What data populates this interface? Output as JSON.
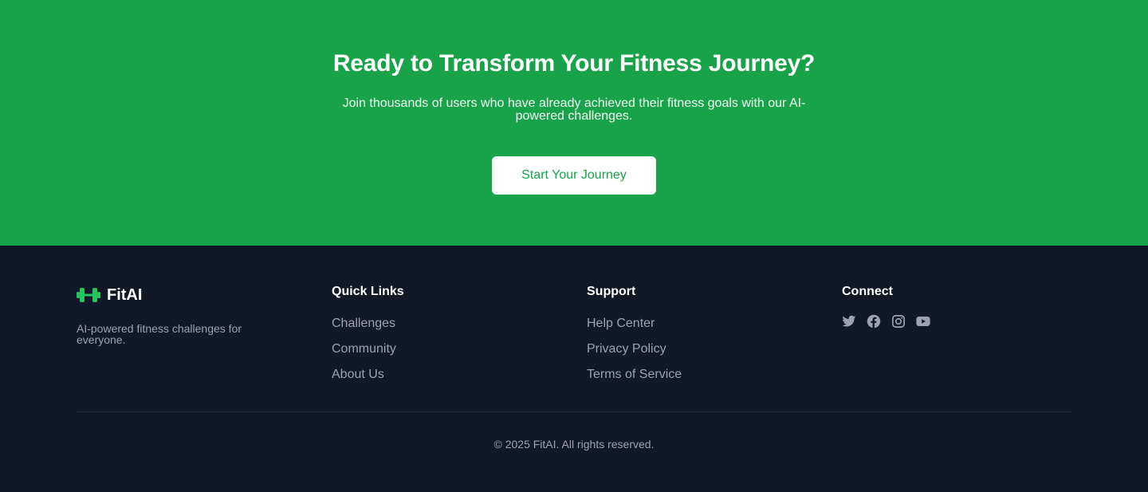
{
  "cta": {
    "title": "Ready to Transform Your Fitness Journey?",
    "subtitle": "Join thousands of users who have already achieved their fitness goals with our AI-powered challenges.",
    "button_label": "Start Your Journey"
  },
  "footer": {
    "brand": {
      "name": "FitAI",
      "icon": "dumbbell-icon",
      "description": "AI-powered fitness challenges for everyone."
    },
    "quick_links": {
      "title": "Quick Links",
      "items": [
        "Challenges",
        "Community",
        "About Us"
      ]
    },
    "support": {
      "title": "Support",
      "items": [
        "Help Center",
        "Privacy Policy",
        "Terms of Service"
      ]
    },
    "connect": {
      "title": "Connect",
      "icons": [
        "twitter-icon",
        "facebook-icon",
        "instagram-icon",
        "youtube-icon"
      ]
    },
    "copyright": "© 2025 FitAI. All rights reserved."
  },
  "colors": {
    "cta_background": "#18a34a",
    "footer_background": "#111827",
    "accent": "#16a34a",
    "muted_text": "#9ca3af"
  }
}
